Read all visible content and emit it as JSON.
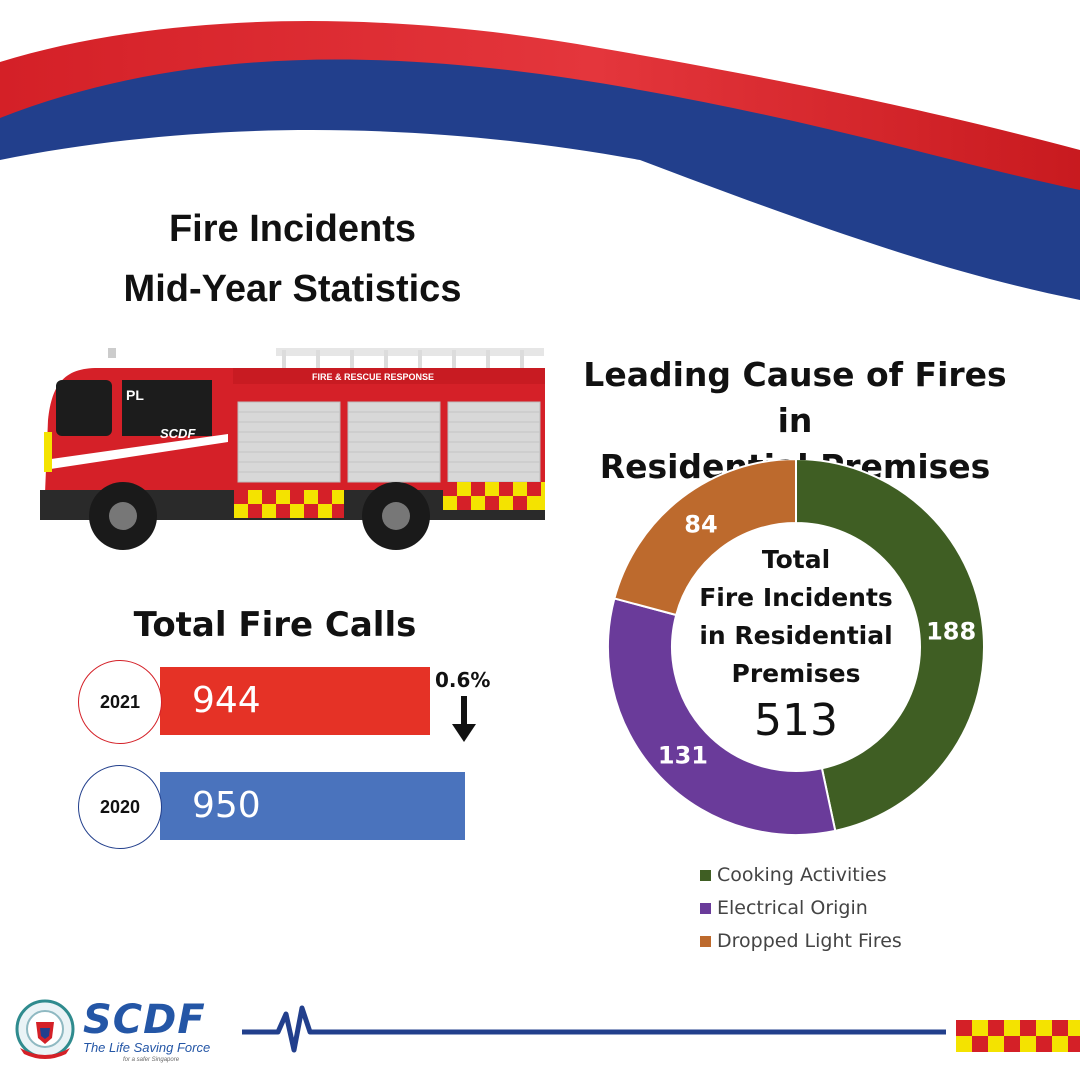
{
  "title": {
    "line1": "Fire Incidents",
    "line2": "Mid-Year Statistics"
  },
  "truck": {
    "panel_text": "FIRE & RESCUE RESPONSE",
    "cab_text": "PL",
    "side_logo": "SCDF"
  },
  "fire_calls": {
    "title": "Total Fire Calls",
    "change": "0.6%",
    "change_direction": "down"
  },
  "donut": {
    "title_line1": "Leading Cause of Fires in",
    "title_line2": "Residential Premises",
    "center_line1": "Total",
    "center_line2": "Fire Incidents",
    "center_line3": "in Residential",
    "center_line4": "Premises",
    "center_total": "513"
  },
  "chart_data": [
    {
      "type": "bar",
      "title": "Total Fire Calls",
      "categories": [
        "2021",
        "2020"
      ],
      "values": [
        944,
        950
      ],
      "colors": [
        "#e53226",
        "#4a73bd"
      ]
    },
    {
      "type": "pie",
      "title": "Leading Cause of Fires in Residential Premises",
      "labels": [
        "Cooking Activities",
        "Electrical Origin",
        "Dropped Light Fires"
      ],
      "values": [
        188,
        131,
        84
      ],
      "colors": [
        "#3f5e23",
        "#6a3b9a",
        "#bd6a2d"
      ],
      "legend_position": "bottom"
    }
  ],
  "footer": {
    "logo_name": "SCDF",
    "tagline": "The Life Saving Force",
    "small_text": "for a safer Singapore"
  },
  "colors": {
    "red": "#d42027",
    "blue": "#223f8c"
  }
}
